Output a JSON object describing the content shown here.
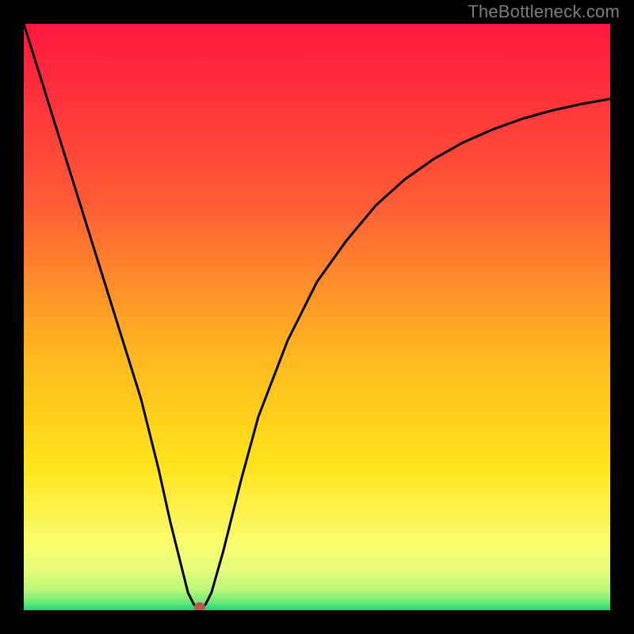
{
  "watermark": "TheBottleneck.com",
  "chart_data": {
    "type": "line",
    "title": "",
    "xlabel": "",
    "ylabel": "",
    "xlim": [
      0,
      100
    ],
    "ylim": [
      0,
      100
    ],
    "grid": false,
    "series": [
      {
        "name": "bottleneck-curve",
        "x": [
          0,
          5,
          10,
          15,
          20,
          23,
          25,
          27,
          28,
          29,
          30,
          31,
          32,
          34,
          37,
          40,
          45,
          50,
          55,
          60,
          65,
          70,
          75,
          80,
          85,
          90,
          95,
          100
        ],
        "values": [
          100,
          84,
          68,
          52,
          36,
          24,
          15,
          7,
          3,
          1,
          0,
          1,
          3,
          10,
          22,
          33,
          46,
          56,
          63,
          69,
          73.5,
          77,
          79.8,
          82,
          83.8,
          85.2,
          86.3,
          87.2
        ]
      }
    ],
    "marker": {
      "x": 30,
      "y": 0,
      "name": "optimum-point"
    },
    "background": {
      "type": "vertical-gradient",
      "stops": [
        {
          "offset": 0.0,
          "color": "#ff173f"
        },
        {
          "offset": 0.3,
          "color": "#ff5a36"
        },
        {
          "offset": 0.55,
          "color": "#ffb321"
        },
        {
          "offset": 0.75,
          "color": "#ffe31a"
        },
        {
          "offset": 0.88,
          "color": "#f9fb6a"
        },
        {
          "offset": 0.93,
          "color": "#e8fc7c"
        },
        {
          "offset": 0.965,
          "color": "#b9f77a"
        },
        {
          "offset": 0.985,
          "color": "#72e976"
        },
        {
          "offset": 1.0,
          "color": "#1ad776"
        }
      ]
    }
  }
}
